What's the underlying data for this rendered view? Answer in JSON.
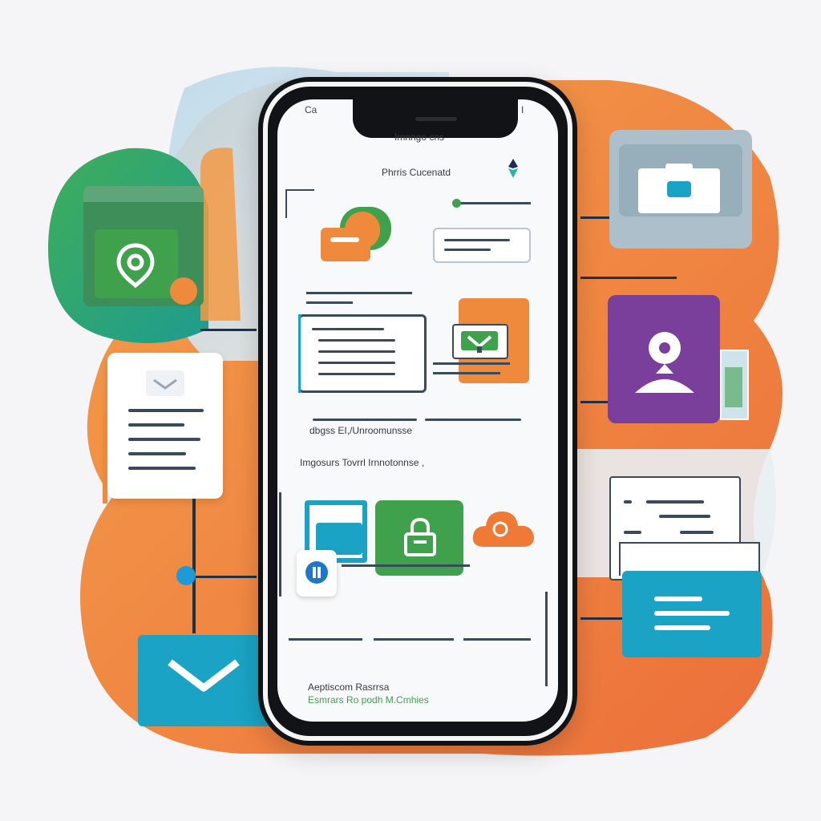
{
  "colors": {
    "orange": "#ef8a3c",
    "green": "#3fa14b",
    "teal": "#1aa3c4",
    "purple": "#7a3f9b",
    "grey_blue": "#aebfcc"
  },
  "screen": {
    "status_left": "Ca",
    "status_right": "I",
    "title": "Imnngo cns",
    "subtitle": "Phrris Cucenatd",
    "section_caption": "dbgss EI,/Unroomunsse",
    "section_heading": "Imgosurs Tovrrl   Irnnotonnse ,",
    "footer_title": "Aeptiscom Rasrrsa",
    "footer_subtitle": "Esmrars Ro podh M.Cmhies"
  },
  "icons": [
    "pin-icon",
    "camera-icon",
    "user-pin-icon",
    "document-icon",
    "mail-icon",
    "note-card-icon",
    "lock-icon",
    "cloud-icon",
    "info-icon"
  ]
}
